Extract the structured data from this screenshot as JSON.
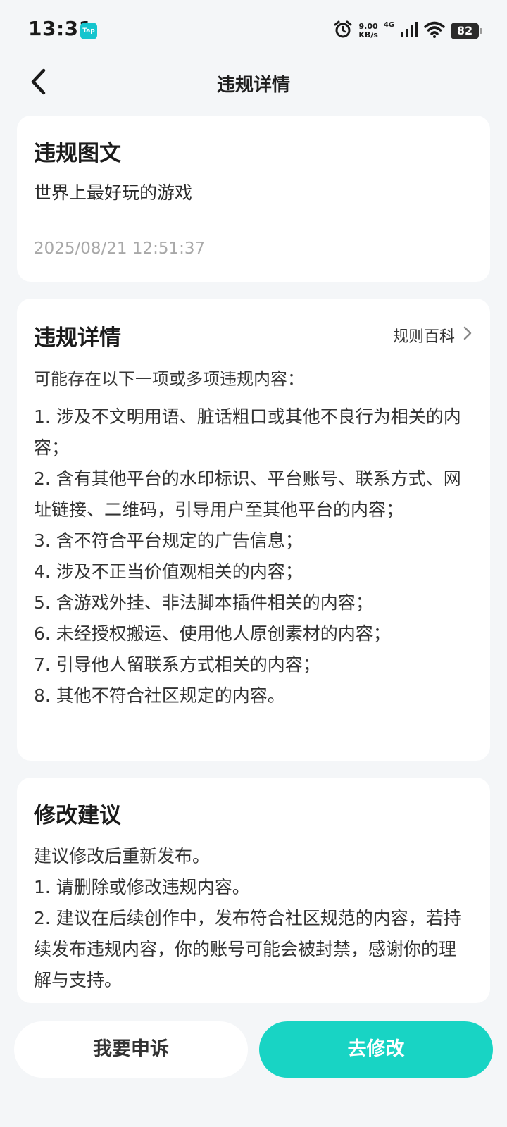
{
  "status_bar": {
    "time": "13:31",
    "app_badge": "Tap",
    "net_speed_value": "9.00",
    "net_speed_unit": "KB/s",
    "network_type": "4G",
    "battery": "82"
  },
  "header": {
    "title": "违规详情"
  },
  "violation_post": {
    "title": "违规图文",
    "content": "世界上最好玩的游戏",
    "timestamp": "2025/08/21 12:51:37"
  },
  "violation_details": {
    "title": "违规详情",
    "rules_link": "规则百科",
    "intro": "可能存在以下一项或多项违规内容：",
    "items": [
      "1. 涉及不文明用语、脏话粗口或其他不良行为相关的内容；",
      "2. 含有其他平台的水印标识、平台账号、联系方式、网址链接、二维码，引导用户至其他平台的内容；",
      "3. 含不符合平台规定的广告信息；",
      "4. 涉及不正当价值观相关的内容；",
      "5. 含游戏外挂、非法脚本插件相关的内容；",
      "6. 未经授权搬运、使用他人原创素材的内容；",
      "7. 引导他人留联系方式相关的内容；",
      "8. 其他不符合社区规定的内容。"
    ]
  },
  "suggestions": {
    "title": "修改建议",
    "lines": [
      "建议修改后重新发布。",
      "1. 请删除或修改违规内容。",
      "2. 建议在后续创作中，发布符合社区规范的内容，若持续发布违规内容，你的账号可能会被封禁，感谢你的理解与支持。"
    ]
  },
  "actions": {
    "appeal_label": "我要申诉",
    "edit_label": "去修改"
  },
  "colors": {
    "accent": "#18d4c4",
    "background": "#f4f6f8",
    "card": "#ffffff"
  }
}
